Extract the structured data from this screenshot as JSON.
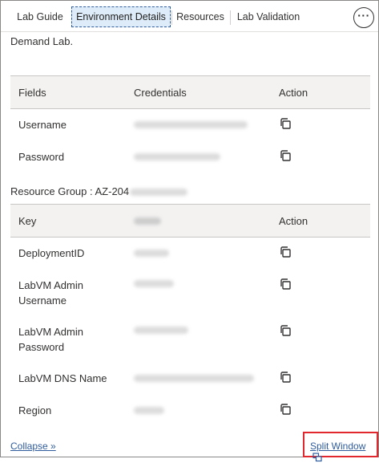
{
  "tabs": [
    {
      "label": "Lab Guide"
    },
    {
      "label": "Environment Details"
    },
    {
      "label": "Resources"
    },
    {
      "label": "Lab Validation"
    }
  ],
  "more_label": "···",
  "intro_text": "Demand Lab.",
  "credentials_table": {
    "headers": [
      "Fields",
      "Credentials",
      "Action"
    ],
    "rows": [
      {
        "field": "Username",
        "value": "[redacted]"
      },
      {
        "field": "Password",
        "value": "[redacted]"
      }
    ]
  },
  "resource_group": {
    "label": "Resource Group : AZ-204",
    "value": "[redacted]"
  },
  "details_table": {
    "headers": [
      "Key",
      "[redacted]",
      "Action"
    ],
    "rows": [
      {
        "key": "DeploymentID",
        "value": "[redacted]"
      },
      {
        "key": "LabVM Admin Username",
        "value": "[redacted]"
      },
      {
        "key": "LabVM Admin Password",
        "value": "[redacted]"
      },
      {
        "key": "LabVM DNS Name",
        "value": "[redacted]"
      },
      {
        "key": "Region",
        "value": "[redacted]"
      }
    ]
  },
  "footer": {
    "collapse_label": "Collapse »",
    "split_label": "Split Window"
  },
  "colors": {
    "link": "#2f5c9c",
    "highlight_border": "#e0282e",
    "active_tab_bg": "#deecf9",
    "header_bg": "#f3f2f1"
  },
  "icons": {
    "copy": "copy-icon",
    "more": "more-options-icon",
    "split": "split-window-icon"
  }
}
